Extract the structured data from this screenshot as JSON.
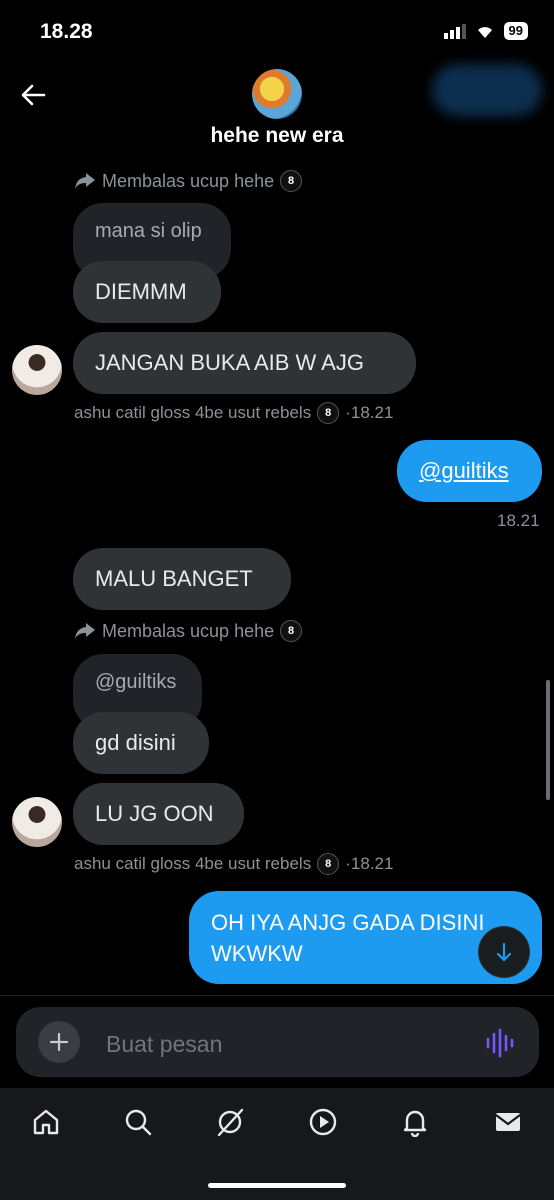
{
  "status_bar": {
    "time": "18.28",
    "battery": "99"
  },
  "header": {
    "title": "hehe new era"
  },
  "messages": {
    "reply1": {
      "prefix": "Membalas ucup hehe",
      "icon": "8"
    },
    "quoted1": "mana si olip",
    "m1": "DIEMMM",
    "m2": "JANGAN BUKA AIB W AJG",
    "meta1": {
      "name": "ashu catil gloss 4be usut rebels",
      "icon": "8",
      "time": "·18.21"
    },
    "me1": "@guiltiks",
    "me1_time": "18.21",
    "m3": "MALU BANGET",
    "reply2": {
      "prefix": "Membalas ucup hehe",
      "icon": "8"
    },
    "quoted2": "@guiltiks",
    "m4": "gd disini",
    "m5": "LU JG OON",
    "meta2": {
      "name": "ashu catil gloss 4be usut rebels",
      "icon": "8",
      "time": "·18.21"
    },
    "me2_line1": "OH IYA ANJG GADA DISINI",
    "me2_line2": "WKWKW"
  },
  "composer": {
    "placeholder": "Buat pesan"
  },
  "nav": [
    "home-icon",
    "search-icon",
    "grok-icon",
    "video-icon",
    "notifications-icon",
    "messages-icon"
  ],
  "colors": {
    "accent": "#1d9bf0",
    "bubble": "#2f3336",
    "voice": "#7856ff"
  }
}
